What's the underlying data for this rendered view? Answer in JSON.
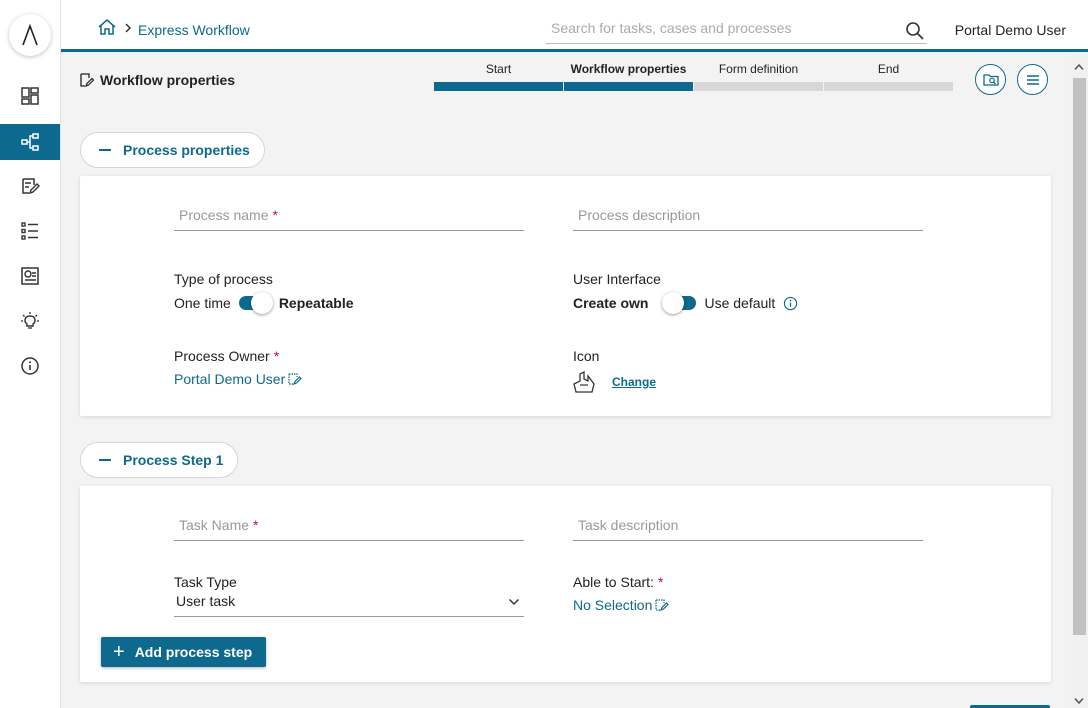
{
  "header": {
    "breadcrumb": "Express Workflow",
    "search_placeholder": "Search for tasks, cases and processes",
    "user": "Portal Demo User"
  },
  "page": {
    "title": "Workflow properties"
  },
  "stepper": {
    "steps": [
      {
        "label": "Start",
        "done": true,
        "active": false
      },
      {
        "label": "Workflow properties",
        "done": true,
        "active": true
      },
      {
        "label": "Form definition",
        "done": false,
        "active": false
      },
      {
        "label": "End",
        "done": false,
        "active": false
      }
    ]
  },
  "process_properties": {
    "section_label": "Process properties",
    "process_name_placeholder": "Process name",
    "process_description_placeholder": "Process description",
    "type_of_process_label": "Type of process",
    "type_option_one_time": "One time",
    "type_option_repeatable": "Repeatable",
    "user_interface_label": "User Interface",
    "ui_option_create_own": "Create own",
    "ui_option_use_default": "Use default",
    "process_owner_label": "Process Owner",
    "process_owner_value": "Portal Demo User",
    "icon_label": "Icon",
    "change_label": "Change",
    "required_mark": "*"
  },
  "process_step": {
    "section_label": "Process Step 1",
    "task_name_placeholder": "Task Name",
    "task_description_placeholder": "Task description",
    "task_type_label": "Task Type",
    "task_type_value": "User task",
    "able_to_start_label": "Able to Start:",
    "able_to_start_value": "No Selection",
    "required_mark": "*"
  },
  "actions": {
    "add_step_label": "Add process step",
    "add_step_icon": "+"
  },
  "colors": {
    "accent": "#0d6a8e",
    "required": "#c8102e"
  }
}
